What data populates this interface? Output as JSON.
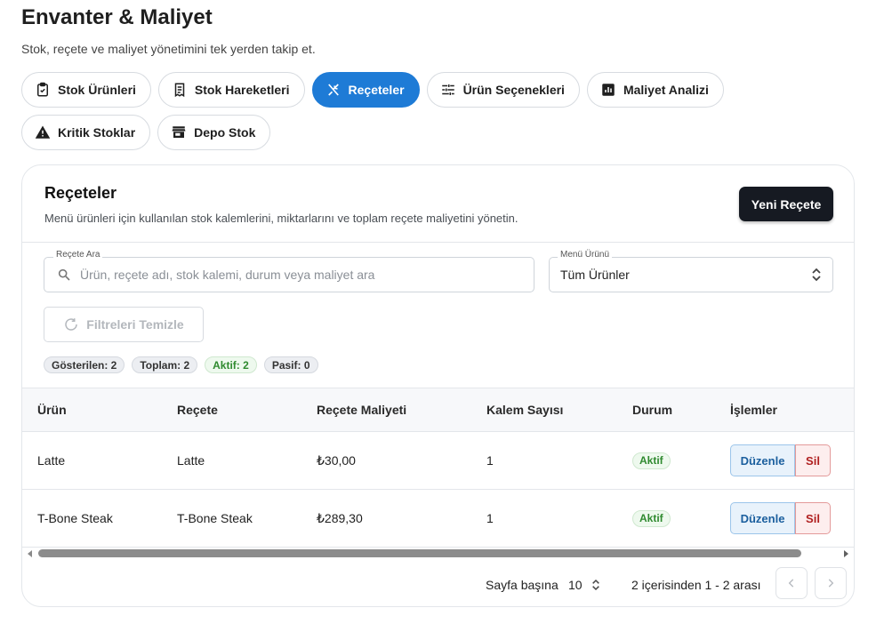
{
  "page": {
    "title": "Envanter & Maliyet",
    "subtitle": "Stok, reçete ve maliyet yönetimini tek yerden takip et."
  },
  "tabs": [
    {
      "label": "Stok Ürünleri",
      "icon": "clipboard-check-icon",
      "active": false
    },
    {
      "label": "Stok Hareketleri",
      "icon": "receipt-icon",
      "active": false
    },
    {
      "label": "Reçeteler",
      "icon": "utensils-icon",
      "active": true
    },
    {
      "label": "Ürün Seçenekleri",
      "icon": "sliders-icon",
      "active": false
    },
    {
      "label": "Maliyet Analizi",
      "icon": "bar-chart-icon",
      "active": false
    },
    {
      "label": "Kritik Stoklar",
      "icon": "warning-icon",
      "active": false
    },
    {
      "label": "Depo Stok",
      "icon": "store-icon",
      "active": false
    }
  ],
  "card": {
    "title": "Reçeteler",
    "description": "Menü ürünleri için kullanılan stok kalemlerini, miktarlarını ve toplam reçete maliyetini yönetin.",
    "new_button": "Yeni Reçete"
  },
  "filters": {
    "search_label": "Reçete Ara",
    "search_placeholder": "Ürün, reçete adı, stok kalemi, durum veya maliyet ara",
    "search_value": "",
    "menu_label": "Menü Ürünü",
    "menu_value": "Tüm Ürünler",
    "clear_button": "Filtreleri Temizle"
  },
  "chips": {
    "shown": "Gösterilen: 2",
    "total": "Toplam: 2",
    "active": "Aktif: 2",
    "passive": "Pasif: 0"
  },
  "table": {
    "headers": [
      "Ürün",
      "Reçete",
      "Reçete Maliyeti",
      "Kalem Sayısı",
      "Durum",
      "İşlemler"
    ],
    "rows": [
      {
        "product": "Latte",
        "recipe": "Latte",
        "cost": "₺30,00",
        "items": "1",
        "status": "Aktif"
      },
      {
        "product": "T-Bone Steak",
        "recipe": "T-Bone Steak",
        "cost": "₺289,30",
        "items": "1",
        "status": "Aktif"
      }
    ],
    "edit_label": "Düzenle",
    "delete_label": "Sil"
  },
  "pagination": {
    "rows_per_page_label": "Sayfa başına",
    "rows_per_page": "10",
    "range": "2 içerisinden 1 - 2 arası"
  },
  "colors": {
    "accent": "#1e7bd6",
    "primary_button": "#161a22",
    "active_green": "#2f8a2f",
    "delete_red": "#b02020"
  }
}
